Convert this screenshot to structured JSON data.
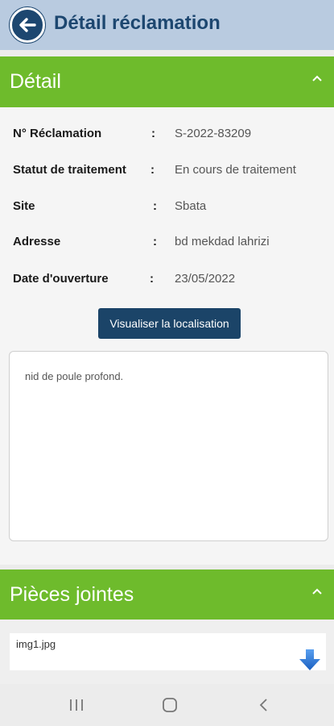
{
  "header": {
    "title": "Détail réclamation",
    "back_icon": "arrow-left-icon"
  },
  "detail_section": {
    "title": "Détail",
    "toggle_icon": "chevron-up-icon",
    "fields": [
      {
        "label": "N° Réclamation",
        "value": "S-2022-83209"
      },
      {
        "label": "Statut de traitement",
        "value": "En cours de traitement"
      },
      {
        "label": "Site",
        "value": "Sbata"
      },
      {
        "label": "Adresse",
        "value": "bd mekdad lahrizi"
      },
      {
        "label": "Date d'ouverture",
        "value": "23/05/2022"
      }
    ],
    "separator": ":",
    "location_button": "Visualiser la localisation",
    "description": "nid de poule profond."
  },
  "attachments_section": {
    "title": "Pièces jointes",
    "toggle_icon": "chevron-up-icon",
    "files": [
      {
        "name": "img1.jpg",
        "action_icon": "download-arrow-icon"
      }
    ]
  },
  "system_nav": {
    "recents_icon": "recents-icon",
    "home_icon": "home-icon",
    "back_icon": "back-chevron-icon"
  },
  "colors": {
    "appbar": "#b9cbe0",
    "primary": "#1d4770",
    "section_green": "#6ebb2c",
    "download_blue": "#1e6fd0"
  }
}
